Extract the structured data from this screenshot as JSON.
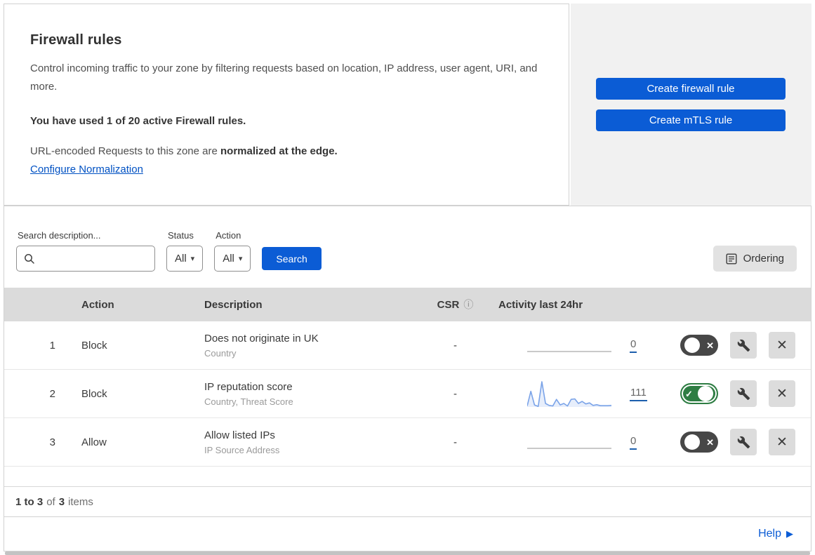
{
  "colors": {
    "accent_blue": "#0b5cd5",
    "link_blue": "#0051c3",
    "toggle_on_green": "#2e7d43",
    "toggle_off_gray": "#474747",
    "sparkline_blue": "#7aa3e8"
  },
  "icons": {
    "chevron_down": "▾",
    "info": "ⓘ",
    "check": "✓",
    "cross": "✕",
    "close": "✕",
    "help_arrow": "▶"
  },
  "intro": {
    "title": "Firewall rules",
    "description": "Control incoming traffic to your zone by filtering requests based on location, IP address, user agent, URI, and more.",
    "usage": "You have used 1 of 20 active Firewall rules.",
    "normalization_prefix": "URL-encoded Requests to this zone are ",
    "normalization_bold": "normalized at the edge.",
    "link": "Configure Normalization"
  },
  "cta": {
    "create_firewall_rule": "Create firewall rule",
    "create_mtls_rule": "Create mTLS rule"
  },
  "filters": {
    "search_label": "Search description...",
    "status_label": "Status",
    "status_value": "All",
    "action_label": "Action",
    "action_value": "All",
    "search_button": "Search",
    "ordering_button": "Ordering"
  },
  "table": {
    "headers": {
      "action": "Action",
      "description": "Description",
      "csr": "CSR",
      "activity": "Activity last 24hr"
    },
    "rows": [
      {
        "priority": "1",
        "action": "Block",
        "description": "Does not originate in UK",
        "fields": "Country",
        "csr": "-",
        "count": "0",
        "enabled": false
      },
      {
        "priority": "2",
        "action": "Block",
        "description": "IP reputation score",
        "fields": "Country, Threat Score",
        "csr": "-",
        "count": "111",
        "enabled": true,
        "sparkline": [
          4,
          62,
          8,
          2,
          100,
          14,
          6,
          4,
          30,
          8,
          14,
          4,
          30,
          32,
          14,
          22,
          12,
          16,
          6,
          9,
          5,
          5,
          5,
          6
        ]
      },
      {
        "priority": "3",
        "action": "Allow",
        "description": "Allow listed IPs",
        "fields": "IP Source Address",
        "csr": "-",
        "count": "0",
        "enabled": false
      }
    ]
  },
  "footer": {
    "range": "1 to 3",
    "of_text": "of",
    "total": "3",
    "items_text": "items"
  },
  "help": {
    "label": "Help"
  }
}
